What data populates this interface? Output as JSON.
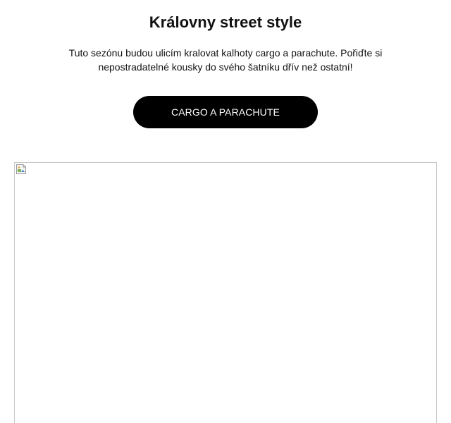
{
  "headline": "Královny street style",
  "intro": {
    "line1": "Tuto sezónu budou ulicím kralovat kalhoty cargo a parachute. Pořiďte si",
    "line2": "nepostradatelné kousky do svého šatníku dřív než ostatní!"
  },
  "cta": {
    "label": "CARGO A PARACHUTE"
  },
  "hero_image": {
    "icon": "broken-image-icon",
    "state": "not loaded"
  },
  "colors": {
    "cta_background": "#000000",
    "cta_text": "#ffffff",
    "text": "#111111",
    "image_border": "#c8c8c8"
  }
}
